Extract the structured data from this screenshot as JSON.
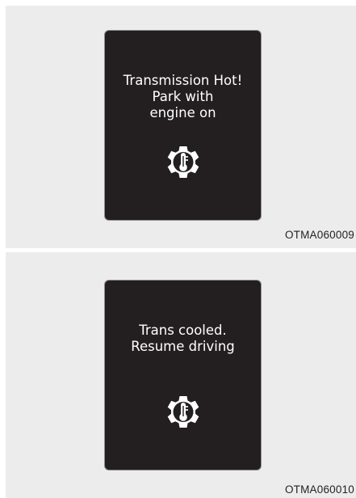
{
  "panels": [
    {
      "lines": [
        "Transmission Hot!",
        "Park with",
        "engine on"
      ],
      "icon": "transmission-temperature-icon",
      "code": "OTMA060009"
    },
    {
      "lines": [
        "Trans cooled.",
        "Resume driving"
      ],
      "icon": "transmission-temperature-icon",
      "code": "OTMA060010"
    }
  ],
  "colors": {
    "panel_background": "#ececec",
    "screen_background": "#231f20",
    "screen_text": "#ffffff",
    "code_text": "#231f20"
  }
}
